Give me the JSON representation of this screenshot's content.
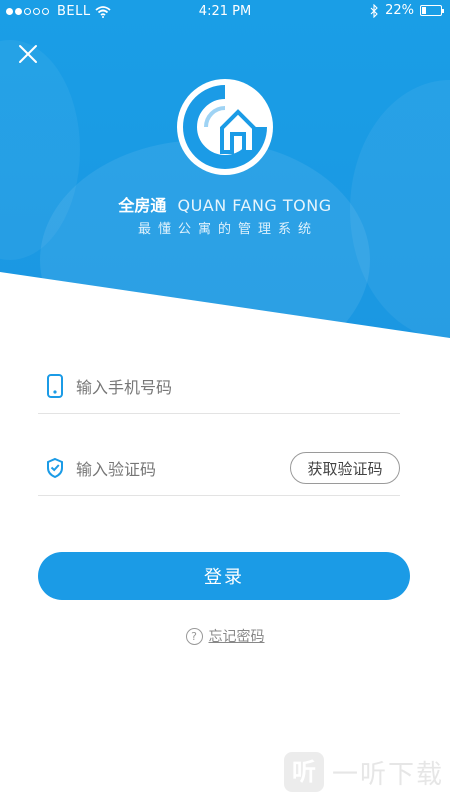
{
  "status_bar": {
    "carrier": "BELL",
    "time": "4:21 PM",
    "battery": "22%",
    "battery_level": 0.22
  },
  "header": {
    "close_icon": "close-icon",
    "logo_icon": "house-logo-icon"
  },
  "brand": {
    "name_cn": "全房通",
    "name_en": "QUAN FANG TONG",
    "slogan": "最懂公寓的管理系统"
  },
  "form": {
    "phone_placeholder": "输入手机号码",
    "phone_value": "",
    "code_placeholder": "输入验证码",
    "code_value": "",
    "get_code_label": "获取验证码",
    "login_label": "登录",
    "forgot_label": "忘记密码"
  },
  "watermark": {
    "mark": "听",
    "text": "一听下载"
  },
  "colors": {
    "primary": "#1b9be6",
    "hero": "#1a9ee6"
  }
}
